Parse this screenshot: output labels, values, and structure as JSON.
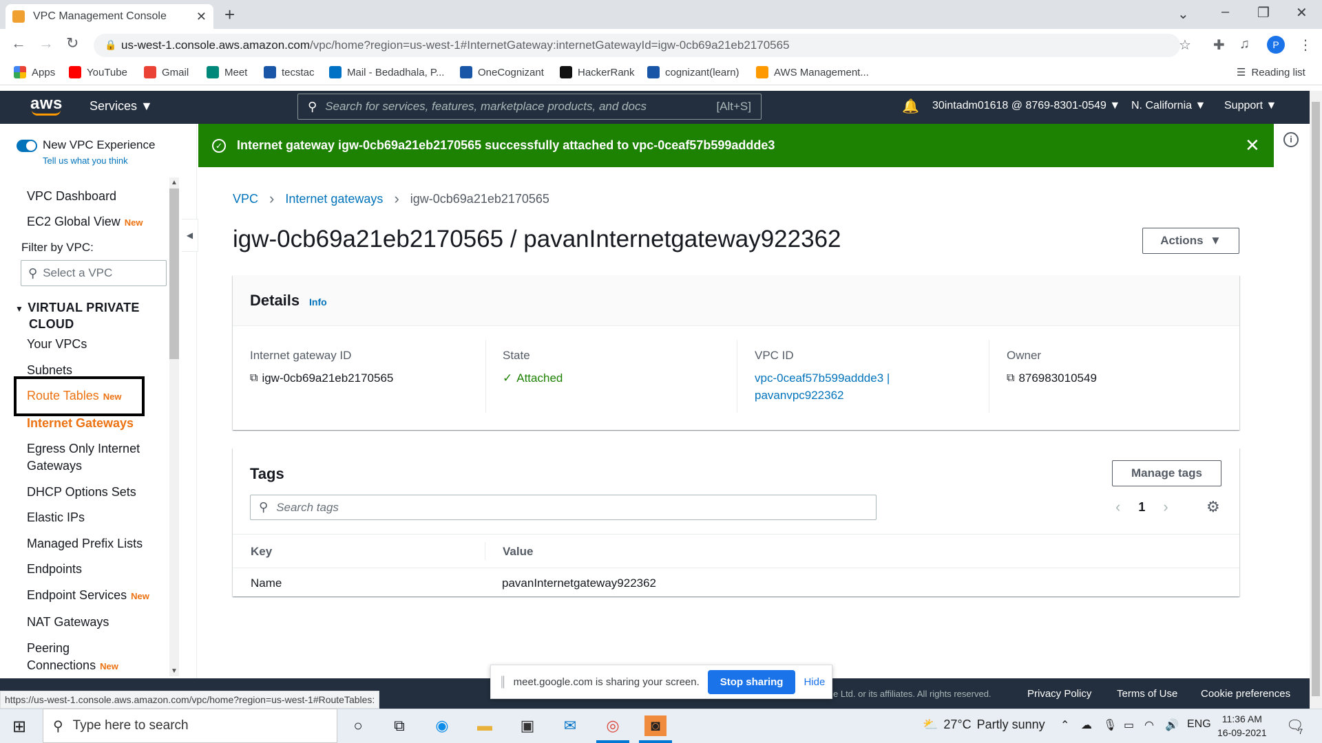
{
  "browser": {
    "tab_title": "VPC Management Console",
    "url_host": "us-west-1.console.aws.amazon.com",
    "url_path": "/vpc/home?region=us-west-1#InternetGateway:internetGatewayId=igw-0cb69a21eb2170565",
    "profile_initial": "P",
    "bookmarks": [
      "Apps",
      "YouTube",
      "Gmail",
      "Meet",
      "tecstac",
      "Mail - Bedadhala, P...",
      "OneCognizant",
      "HackerRank",
      "cognizant(learn)",
      "AWS Management..."
    ],
    "reading_list": "Reading list",
    "status_url": "https://us-west-1.console.aws.amazon.com/vpc/home?region=us-west-1#RouteTables:"
  },
  "aws_header": {
    "logo": "aws",
    "services": "Services",
    "search_placeholder": "Search for services, features, marketplace products, and docs",
    "search_shortcut": "[Alt+S]",
    "account": "30intadm01618 @ 8769-8301-0549",
    "region": "N. California",
    "support": "Support"
  },
  "sidebar": {
    "new_experience": "New VPC Experience",
    "tell_us": "Tell us what you think",
    "dashboard": "VPC Dashboard",
    "ec2_global": "EC2 Global View",
    "new_badge": "New",
    "filter_label": "Filter by VPC:",
    "filter_placeholder": "Select a VPC",
    "section_title_1": "VIRTUAL PRIVATE",
    "section_title_2": "CLOUD",
    "items": [
      "Your VPCs",
      "Subnets",
      "Route Tables",
      "Internet Gateways",
      "Egress Only Internet",
      "Gateways",
      "DHCP Options Sets",
      "Elastic IPs",
      "Managed Prefix Lists",
      "Endpoints",
      "Endpoint Services",
      "NAT Gateways",
      "Peering",
      "Connections"
    ]
  },
  "flash": {
    "message": "Internet gateway igw-0cb69a21eb2170565 successfully attached to vpc-0ceaf57b599addde3"
  },
  "breadcrumb": {
    "vpc": "VPC",
    "igws": "Internet gateways",
    "current": "igw-0cb69a21eb2170565"
  },
  "page": {
    "title": "igw-0cb69a21eb2170565 / pavanInternetgateway922362",
    "actions": "Actions"
  },
  "details": {
    "title": "Details",
    "info": "Info",
    "igw_label": "Internet gateway ID",
    "igw_value": "igw-0cb69a21eb2170565",
    "state_label": "State",
    "state_value": "Attached",
    "vpc_label": "VPC ID",
    "vpc_value_1": "vpc-0ceaf57b599addde3 |",
    "vpc_value_2": "pavanvpc922362",
    "owner_label": "Owner",
    "owner_value": "876983010549"
  },
  "tags": {
    "title": "Tags",
    "manage": "Manage tags",
    "search_placeholder": "Search tags",
    "page": "1",
    "col_key": "Key",
    "col_value": "Value",
    "rows": [
      {
        "key": "Name",
        "value": "pavanInternetgateway922362"
      }
    ]
  },
  "footer": {
    "copyright": "e Ltd. or its affiliates. All rights reserved.",
    "privacy": "Privacy Policy",
    "terms": "Terms of Use",
    "cookies": "Cookie preferences"
  },
  "meet": {
    "message": "meet.google.com is sharing your screen.",
    "stop": "Stop sharing",
    "hide": "Hide"
  },
  "taskbar": {
    "search_placeholder": "Type here to search",
    "temperature": "27°C",
    "weather": "Partly sunny",
    "language": "ENG",
    "time": "11:36 AM",
    "date": "16-09-2021",
    "notifications": "7"
  }
}
